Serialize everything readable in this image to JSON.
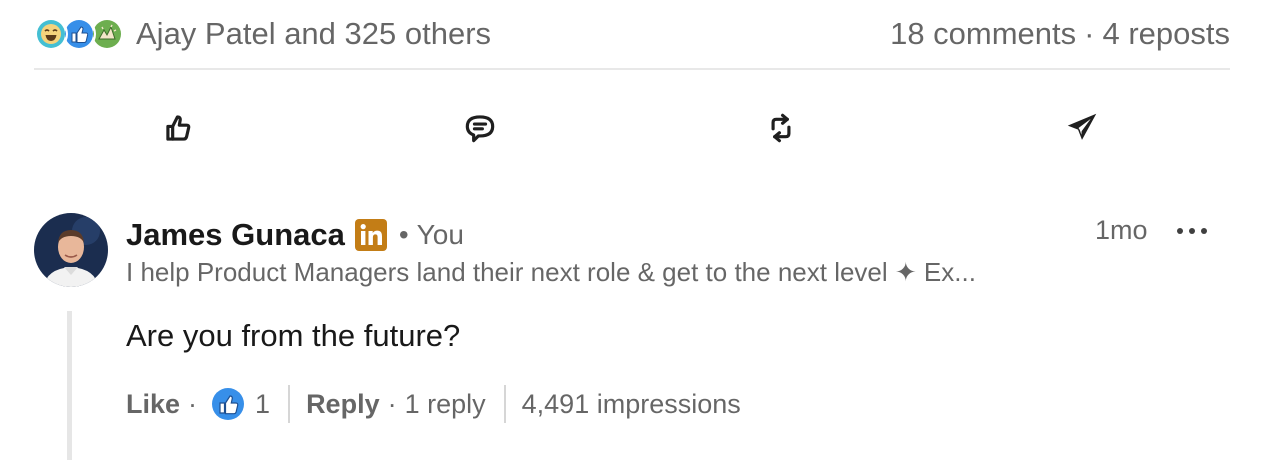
{
  "social_counts": {
    "reactor_summary": "Ajay Patel and 325 others",
    "reaction_icons": [
      "funny-reaction-icon",
      "like-reaction-icon",
      "celebrate-reaction-icon"
    ],
    "comments": "18 comments",
    "separator": "·",
    "reposts": "4 reposts"
  },
  "action_bar": {
    "icons": [
      "like-thumb-icon",
      "comment-bubble-icon",
      "repost-arrows-icon",
      "send-paper-plane-icon"
    ]
  },
  "comment": {
    "author": "James Gunaca",
    "badge_icon": "linkedin-premium-badge-icon",
    "dot": "•",
    "relation": "You",
    "headline": "I help Product Managers land their next role & get to the next level ✦ Ex...",
    "time": "1mo",
    "more_icon": "more-options-icon",
    "text": "Are you from the future?",
    "footer": {
      "like_label": "Like",
      "dot": "·",
      "like_count": "1",
      "reply_label": "Reply",
      "reply_count": "1 reply",
      "impressions": "4,491 impressions"
    }
  },
  "colors": {
    "linkedin_blue": "#0a66c2",
    "like_blue": "#378fe9",
    "premium_gold": "#c37d16",
    "funny_teal": "#44bfd3",
    "celebrate_green": "#6dae4f"
  }
}
